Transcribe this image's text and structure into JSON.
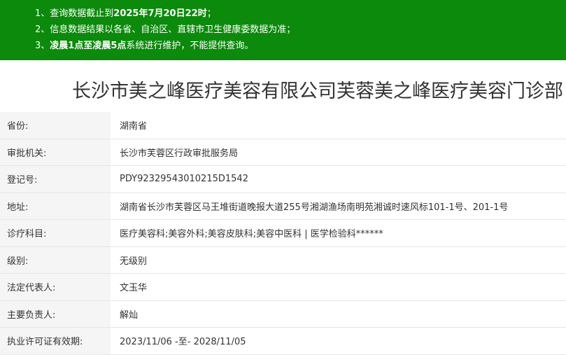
{
  "notice": {
    "line1_prefix": "1、查询数据截止到",
    "line1_bold": "2025年7月20日22时",
    "line1_suffix": "；",
    "line2": "2、信息数据结果以各省、自治区、直辖市卫生健康委数据为准；",
    "line3_prefix": "3、",
    "line3_bold": "凌晨1点至凌晨5点",
    "line3_suffix": "系统进行维护，不能提供查询。"
  },
  "title": "长沙市美之峰医疗美容有限公司芙蓉美之峰医疗美容门诊部",
  "rows": [
    {
      "label": "省份:",
      "value": "湖南省"
    },
    {
      "label": "审批机关:",
      "value": "长沙市芙蓉区行政审批服务局"
    },
    {
      "label": "登记号:",
      "value": "PDY92329543010215D1542"
    },
    {
      "label": "地址:",
      "value": "湖南省长沙市芙蓉区马王堆街道晚报大道255号湘湖渔场南明苑湘诚时速风标101-1号、201-1号"
    },
    {
      "label": "诊疗科目:",
      "value": "医疗美容科;美容外科;美容皮肤科;美容中医科 | 医学检验科******"
    },
    {
      "label": "级别:",
      "value": "无级别"
    },
    {
      "label": "法定代表人:",
      "value": "文玉华"
    },
    {
      "label": "主要负责人:",
      "value": "解灿"
    },
    {
      "label": "执业许可证有效期:",
      "value": "2023/11/06 -至- 2028/11/05"
    }
  ],
  "colors": {
    "notice_bg": "#0b8a0b",
    "label_bg": "#f5f5f5"
  }
}
